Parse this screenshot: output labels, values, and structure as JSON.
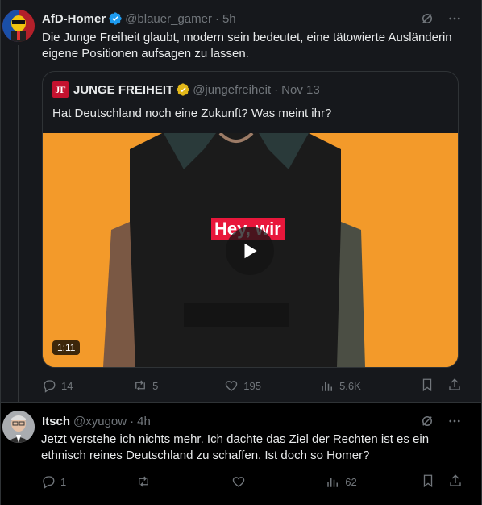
{
  "tweets": [
    {
      "name": "AfD-Homer",
      "handle": "@blauer_gamer",
      "time": "5h",
      "text": "Die Junge Freiheit glaubt, modern sein bedeutet, eine tätowierte Ausländerin eigene Positionen aufsagen zu lassen.",
      "quote": {
        "logo": "JF",
        "name": "JUNGE FREIHEIT",
        "handle": "@jungefreiheit",
        "time": "Nov 13",
        "text": "Hat Deutschland noch eine Zukunft? Was meint ihr?",
        "video_caption": "Hey, wir",
        "duration": "1:11"
      },
      "stats": {
        "replies": "14",
        "reposts": "5",
        "likes": "195",
        "views": "5.6K"
      }
    },
    {
      "name": "Itsch",
      "handle": "@xyugow",
      "time": "4h",
      "text": "Jetzt verstehe ich nichts mehr. Ich dachte das Ziel der Rechten ist es ein ethnisch reines Deutschland zu schaffen. Ist doch so Homer?",
      "stats": {
        "replies": "1",
        "reposts": "",
        "likes": "",
        "views": "62"
      }
    }
  ],
  "colors": {
    "verified_blue": "#1d9bf0",
    "verified_gold": "#e2b719",
    "muted": "#71767b",
    "video_bg": "#f39a2a"
  },
  "icons": [
    "verified-icon",
    "grok-icon",
    "more-icon",
    "reply-icon",
    "repost-icon",
    "like-icon",
    "views-icon",
    "bookmark-icon",
    "share-icon",
    "play-icon"
  ]
}
